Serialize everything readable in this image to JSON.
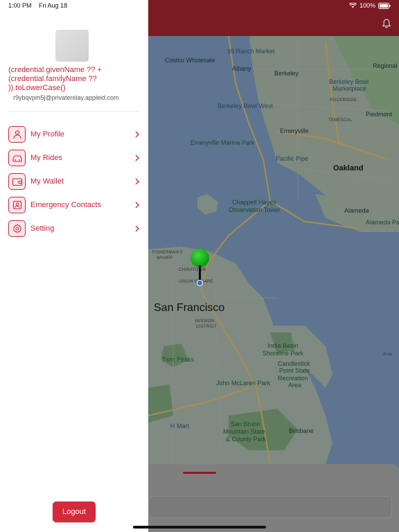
{
  "status_bar": {
    "time": "1:00 PM",
    "date": "Fri Aug 18",
    "battery": "100%"
  },
  "profile": {
    "name": "(credential.givenName ?? + (credential.familyName ?? )).toLowerCase()",
    "email": "r9ybqvpm5j@privaterelay.appleid.com"
  },
  "menu": {
    "items": [
      {
        "label": "My Profile",
        "icon": "person-icon"
      },
      {
        "label": "My Rides",
        "icon": "car-icon"
      },
      {
        "label": "My Wallet",
        "icon": "wallet-icon"
      },
      {
        "label": "Emergency Contacts",
        "icon": "contact-card-icon"
      },
      {
        "label": "Setting",
        "icon": "gear-icon"
      }
    ]
  },
  "logout_label": "Logout",
  "map": {
    "labels": {
      "rebank": "99 Ranch Market",
      "costco": "Costco Wholesale",
      "albany": "Albany",
      "berkeley": "Berkeley",
      "berkeley_bowl": "Berkeley Bowl",
      "marketplace": "Marketplace",
      "bowl_west": "Berkeley Bowl West",
      "rockridge": "ROCKRIDGE",
      "piedmont": "Piedmont",
      "temescal": "TEMESCAL",
      "emeryville": "Emeryville",
      "marina_park": "Emeryville Marina Park",
      "pacific_pipe": "Pacific Pipe",
      "oakland": "Oakland",
      "chappell": "Chappell Hayes",
      "observation": "Observation Tower",
      "alameda": "Alameda",
      "alameda_park": "Alameda Park",
      "fishermans": "FISHERMAN'S",
      "wharf": "WHARF",
      "chinatown": "CHINATOWN",
      "union_square": "UNION SQUARE",
      "san_francisco": "San Francisco",
      "mission": "MISSION",
      "district": "DISTRICT",
      "india_basin": "India Basin",
      "shoreline": "Shoreline Park",
      "twin_peaks": "Twin Peaks",
      "candlestick": "Candlestick",
      "point_state": "Point State",
      "recreation": "Recreation",
      "area": "Area",
      "mclaren": "John McLaren Park",
      "hmart": "H Mart",
      "san_bruno": "San Bruno",
      "mountain_state": "Mountain State",
      "county_park": "& County Park",
      "brisbane": "Brisbane",
      "regional": "Regional",
      "ares": "Ares"
    }
  },
  "colors": {
    "accent": "#c0263a",
    "button": "#d42a3c",
    "topbar_dimmed": "#7b1a22"
  }
}
